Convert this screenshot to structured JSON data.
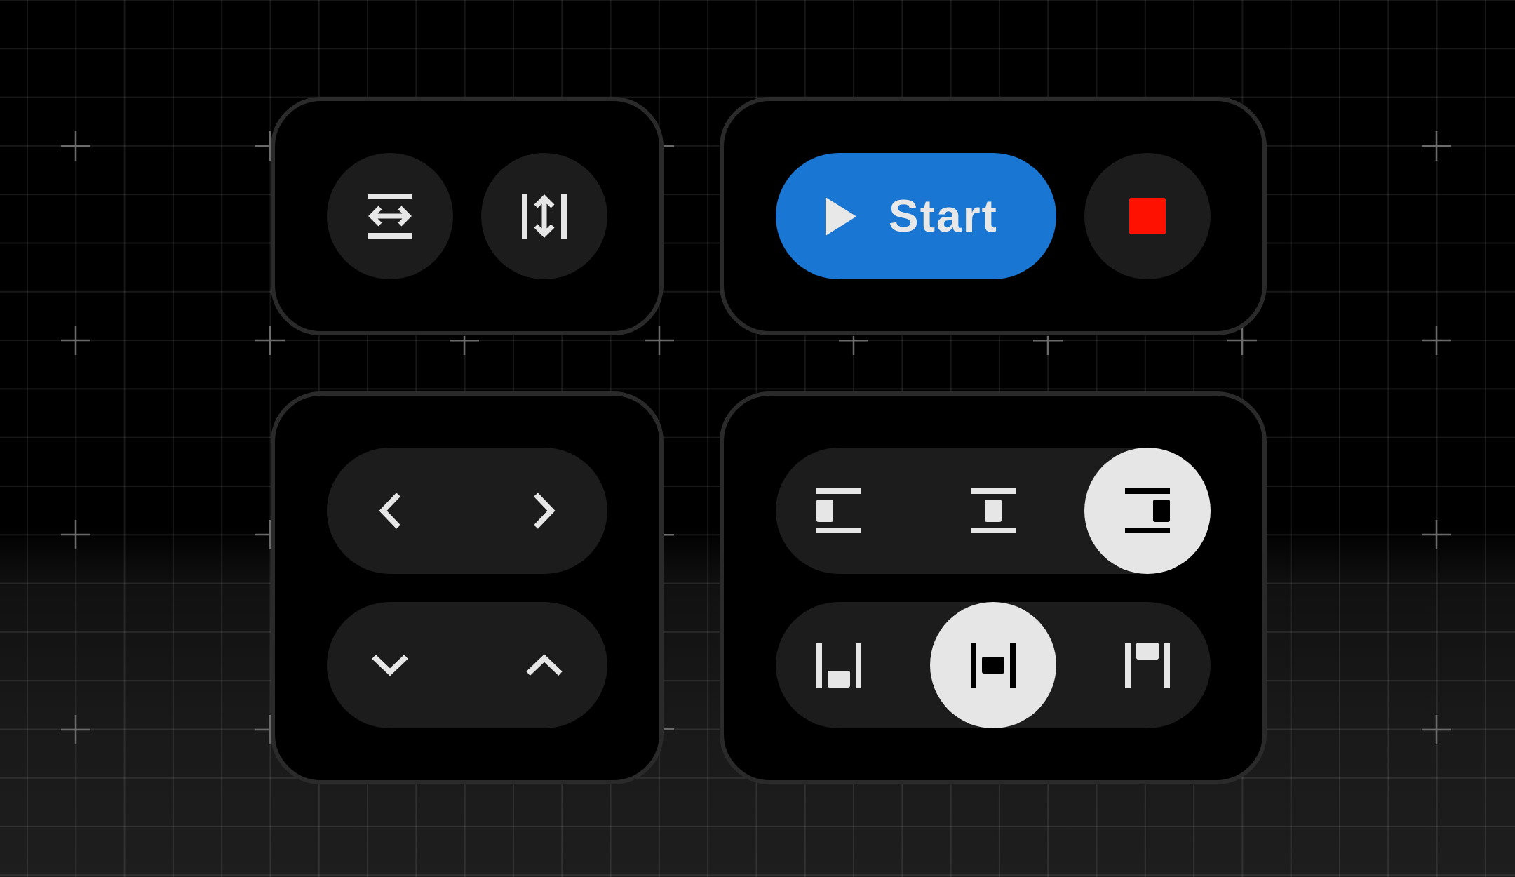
{
  "spacing_buttons": [
    {
      "kind": "horizontal"
    },
    {
      "kind": "vertical"
    }
  ],
  "playback": {
    "start_label": "Start"
  },
  "arrow_groups": [
    {
      "buttons": [
        {
          "kind": "left"
        },
        {
          "kind": "right"
        }
      ]
    },
    {
      "buttons": [
        {
          "kind": "down"
        },
        {
          "kind": "up"
        }
      ]
    }
  ],
  "alignment_groups": [
    {
      "options": [
        {
          "kind": "left",
          "selected": false
        },
        {
          "kind": "center",
          "selected": false
        },
        {
          "kind": "right",
          "selected": true
        }
      ]
    },
    {
      "options": [
        {
          "kind": "bottom",
          "selected": false
        },
        {
          "kind": "middle",
          "selected": true
        },
        {
          "kind": "top",
          "selected": false
        }
      ]
    }
  ]
}
